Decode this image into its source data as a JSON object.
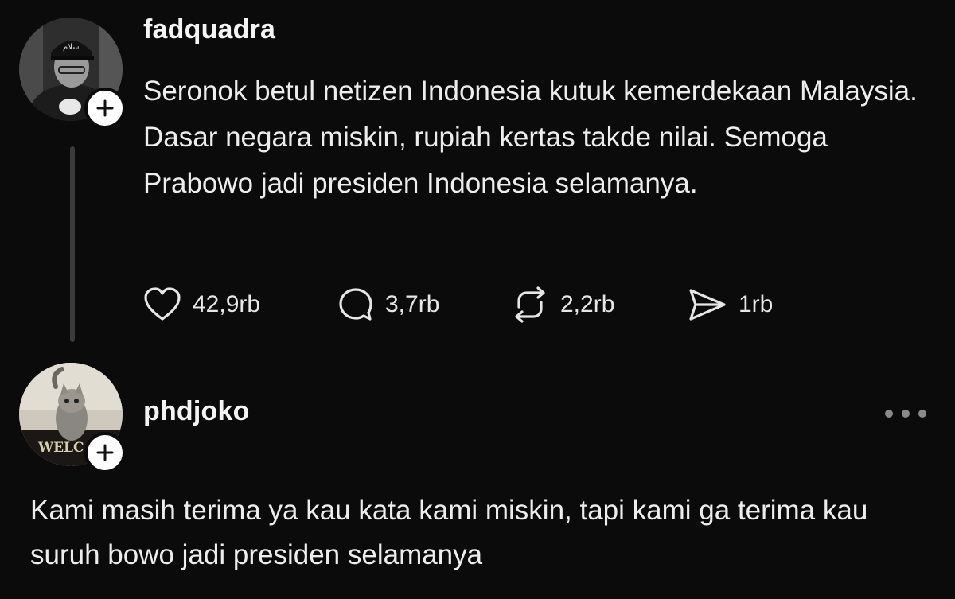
{
  "post": {
    "username": "fadquadra",
    "text": "Seronok betul netizen Indonesia kutuk kemerdekaan Malaysia. Dasar negara miskin, rupiah kertas takde nilai. Semoga Prabowo jadi presiden Indonesia selamanya.",
    "actions": {
      "likes": "42,9rb",
      "replies": "3,7rb",
      "reposts": "2,2rb",
      "shares": "1rb"
    },
    "avatar_cap_text": "سلام"
  },
  "reply": {
    "username": "phdjoko",
    "text": "Kami masih terima ya kau kata kami miskin, tapi kami ga terima kau suruh bowo jadi presiden selamanya",
    "avatar_mat_text": "WELC"
  },
  "icons": {
    "like": "heart-icon",
    "reply": "comment-icon",
    "repost": "repost-icon",
    "share": "send-icon",
    "follow": "plus-icon",
    "more": "more-dots-icon"
  },
  "colors": {
    "background": "#0b0b0b",
    "text": "#ededed",
    "thread_line": "#3b3b3b"
  }
}
